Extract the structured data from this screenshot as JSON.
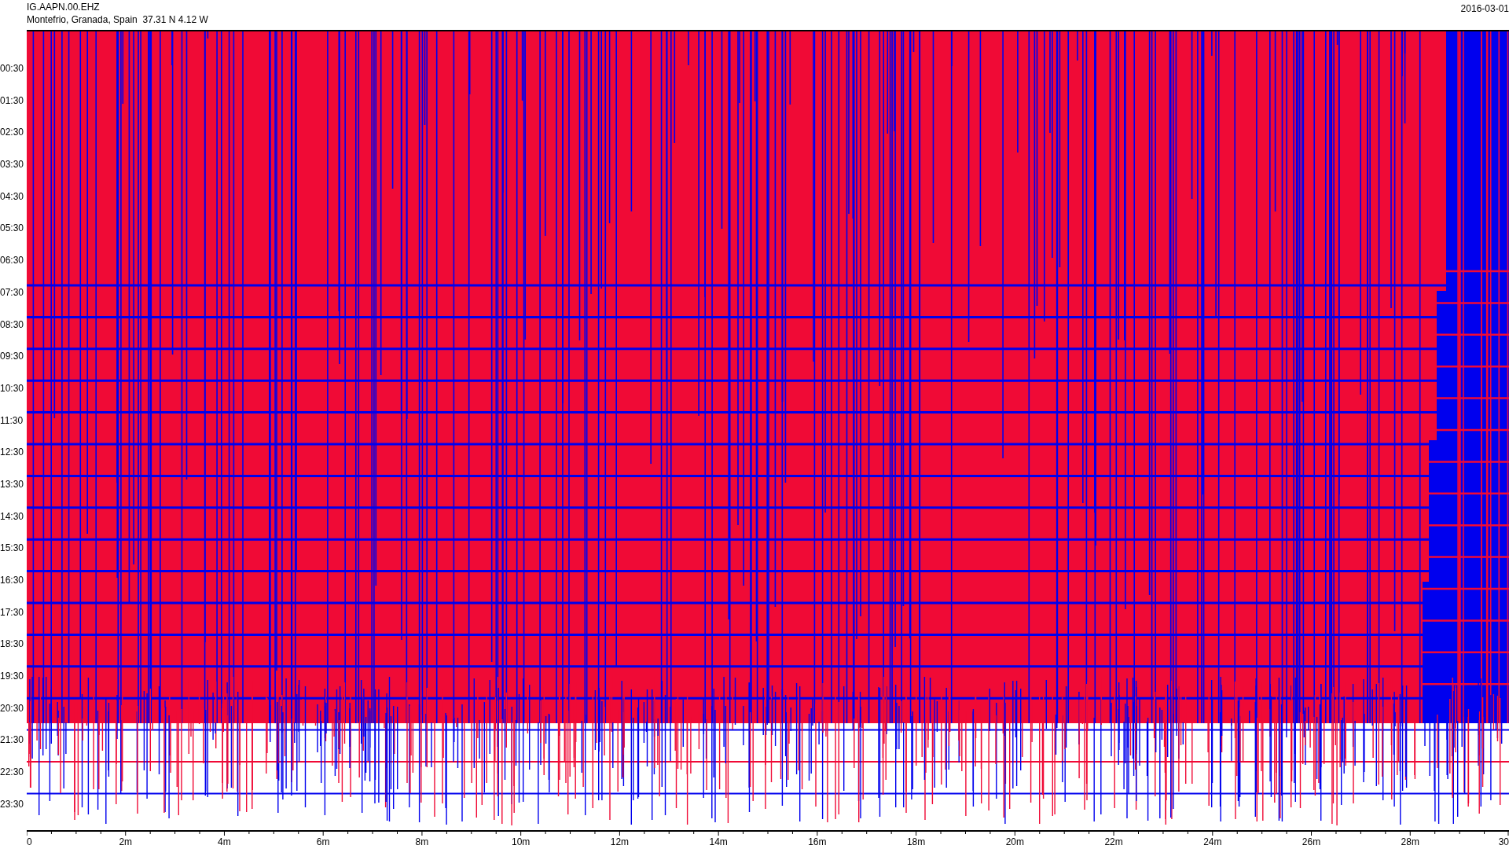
{
  "header": {
    "station": "IG.AAPN.00.EHZ",
    "location": "Montefrio, Granada, Spain  37.31 N 4.12 W",
    "date": "2016-03-01"
  },
  "helicorder": {
    "y_labels": [
      "00:30",
      "01:30",
      "02:30",
      "03:30",
      "04:30",
      "05:30",
      "06:30",
      "07:30",
      "08:30",
      "09:30",
      "10:30",
      "11:30",
      "12:30",
      "13:30",
      "14:30",
      "15:30",
      "16:30",
      "17:30",
      "18:30",
      "19:30",
      "20:30",
      "21:30",
      "22:30",
      "23:30"
    ],
    "x_labels": [
      "0",
      "2m",
      "4m",
      "6m",
      "8m",
      "10m",
      "12m",
      "14m",
      "16m",
      "18m",
      "20m",
      "22m",
      "24m",
      "26m",
      "28m",
      "30"
    ]
  }
}
